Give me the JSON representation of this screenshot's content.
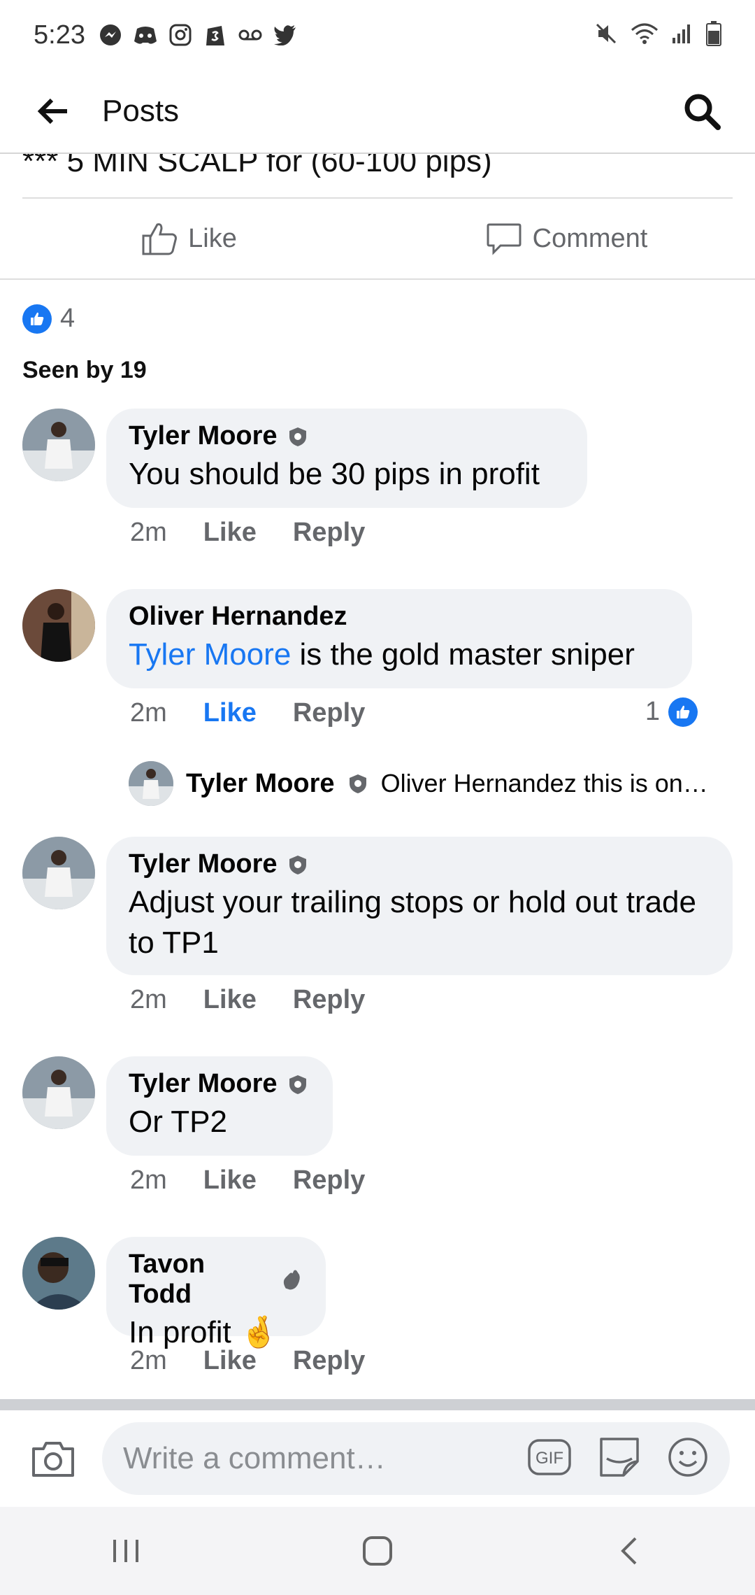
{
  "status_bar": {
    "time": "5:23",
    "left_icons": [
      "messenger-icon",
      "discord-icon",
      "instagram-icon",
      "shopify-icon",
      "voicemail-icon",
      "twitter-icon"
    ],
    "right_icons": [
      "mute-icon",
      "wifi-icon",
      "signal-icon",
      "battery-icon"
    ]
  },
  "header": {
    "title": "Posts"
  },
  "post": {
    "title_fragment": "*** 5 MIN SCALP for (60-100 pips)",
    "like_label": "Like",
    "comment_label": "Comment",
    "reaction_count": "4",
    "seen_by": "Seen by 19"
  },
  "comments": [
    {
      "name": "Tyler Moore",
      "badge": "shield",
      "text": "You should be 30 pips in profit",
      "time": "2m",
      "like": "Like",
      "reply": "Reply"
    },
    {
      "name": "Oliver Hernandez",
      "mention": "Tyler Moore",
      "text": " is the gold master sniper",
      "time": "2m",
      "like": "Like",
      "reply": "Reply",
      "liked": true,
      "reactions": "1"
    },
    {
      "name": "Tyler Moore",
      "badge": "shield",
      "text": "Adjust your trailing stops or hold out trade to TP1",
      "time": "2m",
      "like": "Like",
      "reply": "Reply"
    },
    {
      "name": "Tyler Moore",
      "badge": "shield",
      "text": "Or TP2",
      "time": "2m",
      "like": "Like",
      "reply": "Reply"
    },
    {
      "name": "Tavon Todd",
      "badge": "wave",
      "text": "In profit 🤞",
      "time": "2m",
      "like": "Like",
      "reply": "Reply"
    }
  ],
  "reply_preview": {
    "name": "Tyler Moore",
    "text": "Oliver Hernandez this is on…"
  },
  "composer": {
    "placeholder": "Write a comment…"
  },
  "colors": {
    "accent": "#1877f2",
    "bubble": "#f0f2f5",
    "meta": "#65676b"
  }
}
